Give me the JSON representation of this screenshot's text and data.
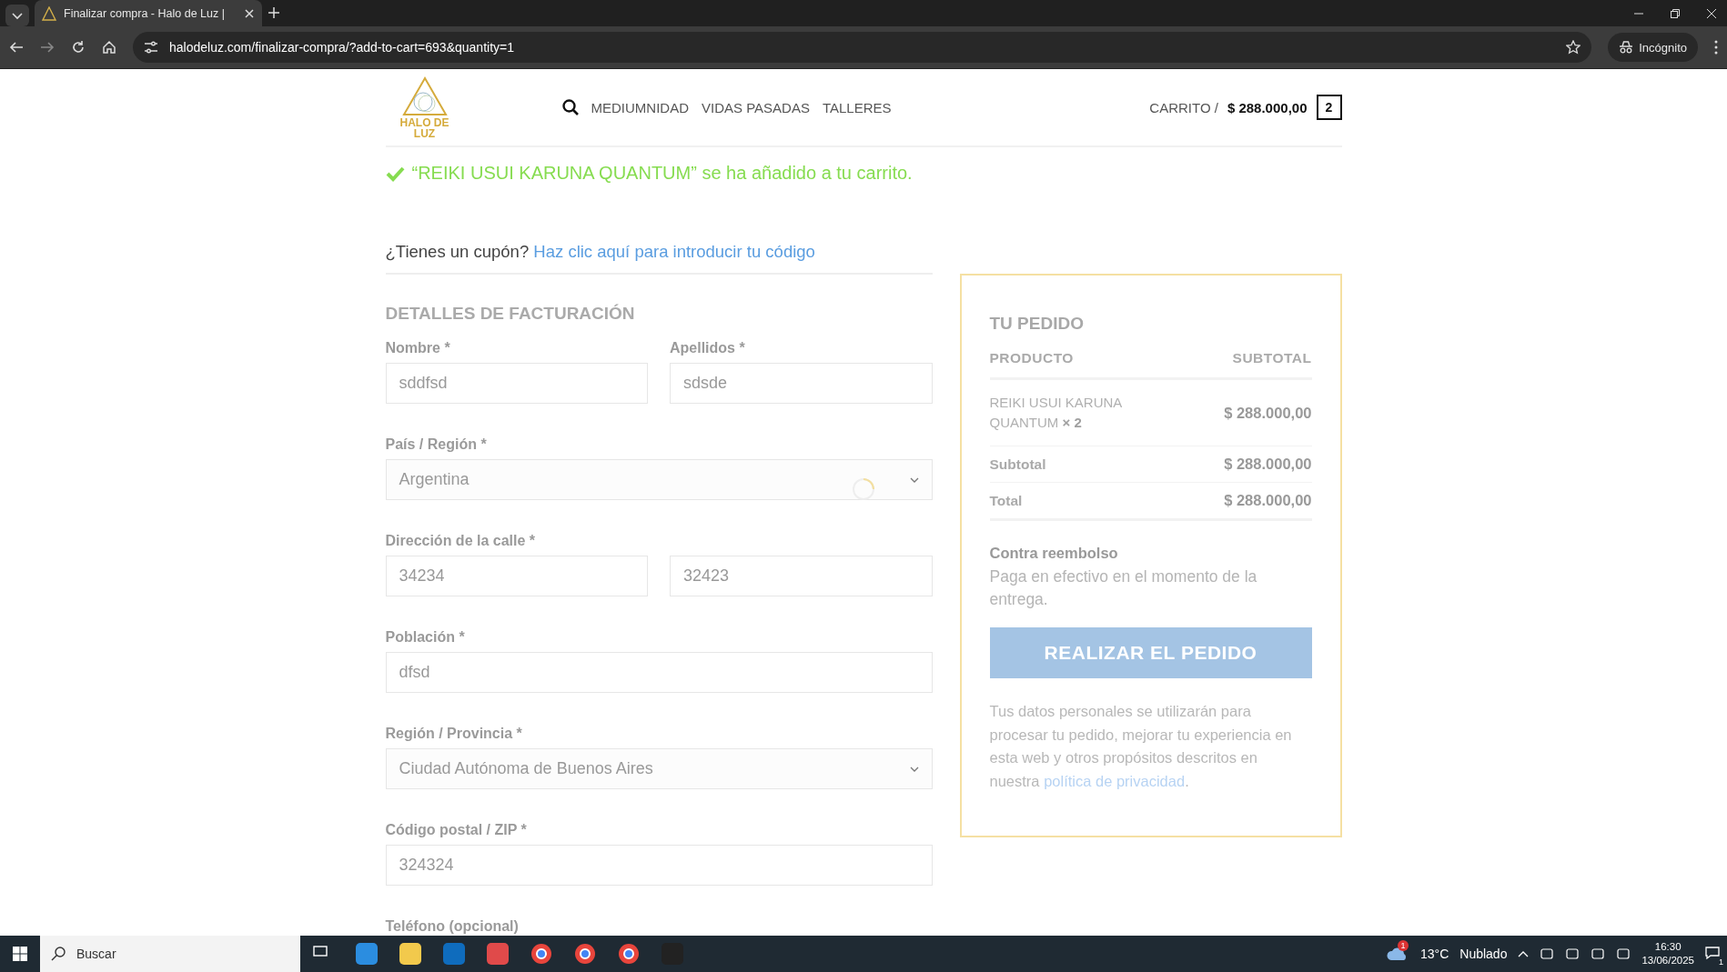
{
  "browser": {
    "tab_title": "Finalizar compra - Halo de Luz |",
    "url": "halodeluz.com/finalizar-compra/?add-to-cart=693&quantity=1",
    "profile": "Incógnito"
  },
  "header": {
    "logo_text": "HALO DE LUZ",
    "nav": [
      "MEDIUMNIDAD",
      "VIDAS PASADAS",
      "TALLERES"
    ],
    "cart_label": "CARRITO /",
    "cart_total": "$ 288.000,00",
    "cart_count": "2"
  },
  "notice": "“REIKI USUI KARUNA QUANTUM” se ha añadido a tu carrito.",
  "coupon": {
    "question": "¿Tienes un cupón?",
    "link": "Haz clic aquí para introducir tu código"
  },
  "billing": {
    "title": "DETALLES DE FACTURACIÓN",
    "rows": [
      {
        "fields": [
          {
            "label": "Nombre *",
            "kind": "text",
            "value": "sddfsd"
          },
          {
            "label": "Apellidos *",
            "kind": "text",
            "value": "sdsde"
          }
        ]
      },
      {
        "fields": [
          {
            "label": "País / Región *",
            "kind": "select",
            "value": "Argentina",
            "loading": true
          }
        ]
      },
      {
        "fields": [
          {
            "label": "Dirección de la calle *",
            "kind": "text",
            "value": "34234"
          },
          {
            "kind": "text",
            "value": "32423"
          }
        ]
      },
      {
        "fields": [
          {
            "label": "Población *",
            "kind": "text",
            "value": "dfsd"
          }
        ]
      },
      {
        "fields": [
          {
            "label": "Región / Provincia *",
            "kind": "select",
            "value": "Ciudad Autónoma de Buenos Aires",
            "loading": false
          }
        ]
      },
      {
        "fields": [
          {
            "label": "Código postal / ZIP *",
            "kind": "text",
            "value": "324324"
          }
        ]
      },
      {
        "fields": [
          {
            "label": "Teléfono (opcional)",
            "kind": "label"
          }
        ]
      }
    ]
  },
  "order": {
    "title": "TU PEDIDO",
    "columns": [
      "PRODUCTO",
      "SUBTOTAL"
    ],
    "items": [
      {
        "name": "REIKI USUI KARUNA QUANTUM",
        "quantity": "× 2",
        "subtotal": "$ 288.000,00"
      }
    ],
    "totals": [
      {
        "label": "Subtotal",
        "value": "$ 288.000,00"
      },
      {
        "label": "Total",
        "value": "$ 288.000,00"
      }
    ],
    "payment": {
      "title": "Contra reembolso",
      "description": "Paga en efectivo en el momento de la entrega."
    },
    "button": "REALIZAR EL PEDIDO",
    "privacy": {
      "text": "Tus datos personales se utilizarán para procesar tu pedido, mejorar tu experiencia en esta web y otros propósitos descritos en nuestra",
      "link": "política de privacidad",
      "end": "."
    }
  },
  "taskbar": {
    "search_placeholder": "Buscar",
    "weather_badge": "1",
    "temperature": "13°C",
    "weather": "Nublado",
    "time": "16:30",
    "date": "13/06/2025",
    "notifications": "1"
  }
}
